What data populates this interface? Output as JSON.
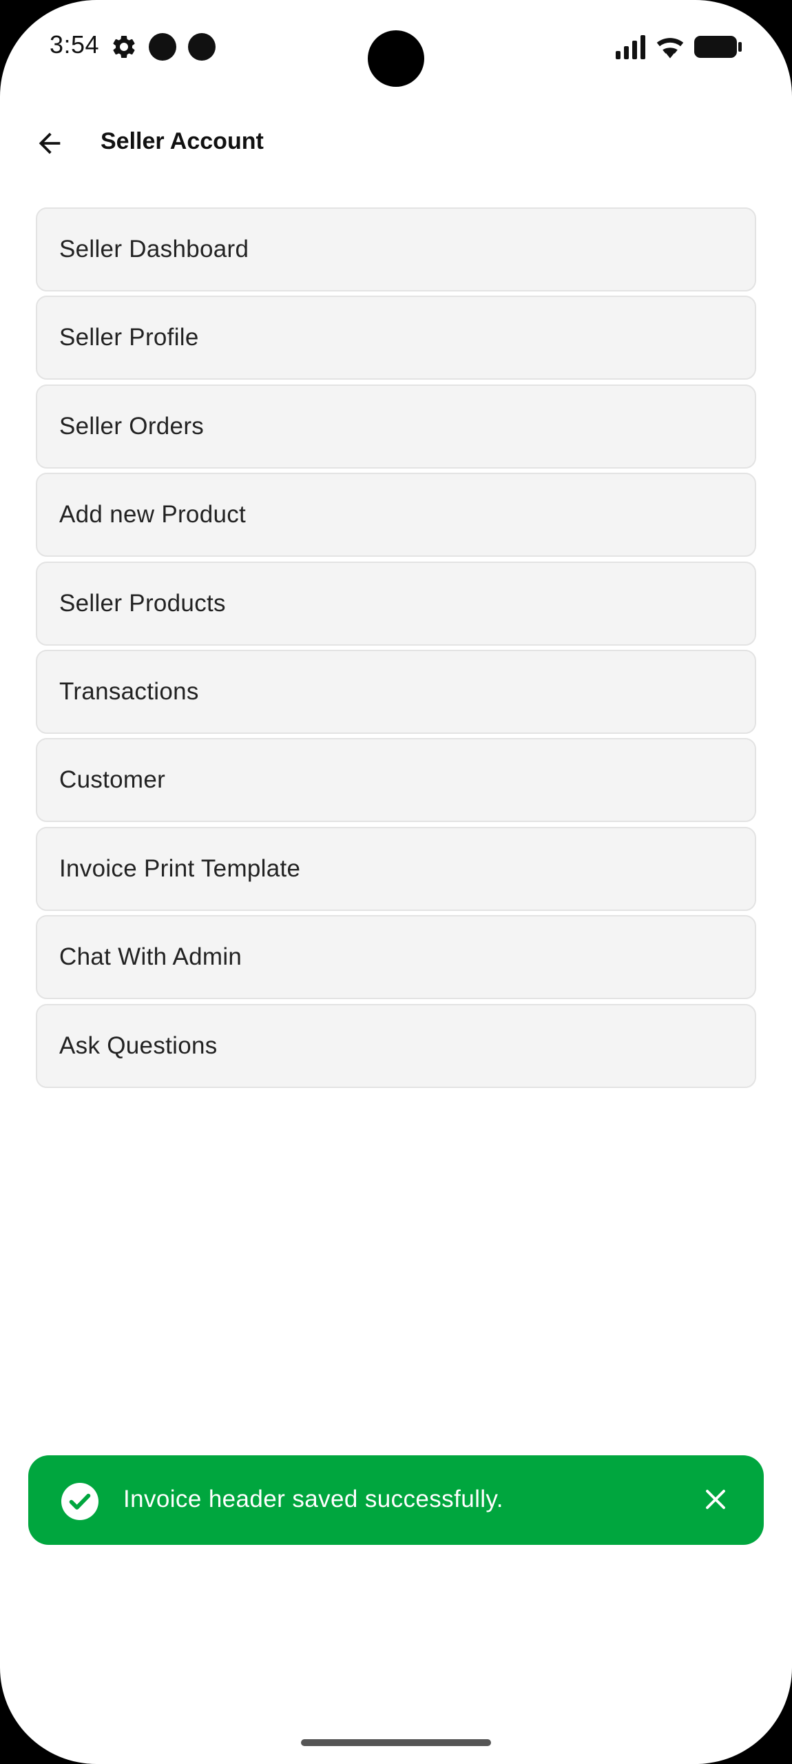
{
  "status_bar": {
    "time": "3:54",
    "icons": [
      "settings-gear-icon",
      "notification-dot-icon",
      "notification-dot-icon",
      "signal-icon",
      "wifi-icon",
      "battery-icon"
    ]
  },
  "app_bar": {
    "back_icon": "arrow-left-icon",
    "title": "Seller Account"
  },
  "menu": {
    "items": [
      {
        "label": "Seller Dashboard"
      },
      {
        "label": "Seller Profile"
      },
      {
        "label": "Seller Orders"
      },
      {
        "label": "Add new Product"
      },
      {
        "label": "Seller Products"
      },
      {
        "label": "Transactions"
      },
      {
        "label": "Customer"
      },
      {
        "label": "Invoice Print Template"
      },
      {
        "label": "Chat With Admin"
      },
      {
        "label": "Ask Questions"
      }
    ]
  },
  "snackbar": {
    "icon": "check-circle-icon",
    "message": "Invoice header saved successfully.",
    "close_icon": "close-icon",
    "color": "#00a63e"
  },
  "colors": {
    "menu_item_bg": "#f4f4f4",
    "menu_item_border": "#e3e3e3",
    "background": "#ffffff",
    "text": "#222222"
  }
}
